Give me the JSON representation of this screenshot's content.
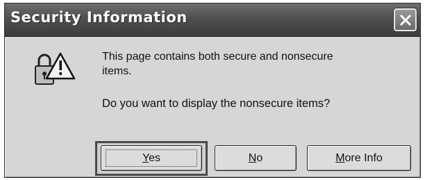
{
  "window": {
    "title": "Security Information",
    "close_icon": "close-icon"
  },
  "content": {
    "warning_icon": "security-warning-icon",
    "message_line1": "This page contains both secure and nonsecure",
    "message_line2": "items.",
    "question": "Do you want to display the nonsecure items?"
  },
  "buttons": {
    "yes": {
      "mnemonic": "Y",
      "rest": "es"
    },
    "no": {
      "mnemonic": "N",
      "rest": "o"
    },
    "more_info": {
      "mnemonic": "M",
      "rest": "ore Info"
    }
  },
  "colors": {
    "titlebar": "#505050",
    "dialog_bg": "#d6d6d6",
    "text": "#111111"
  }
}
